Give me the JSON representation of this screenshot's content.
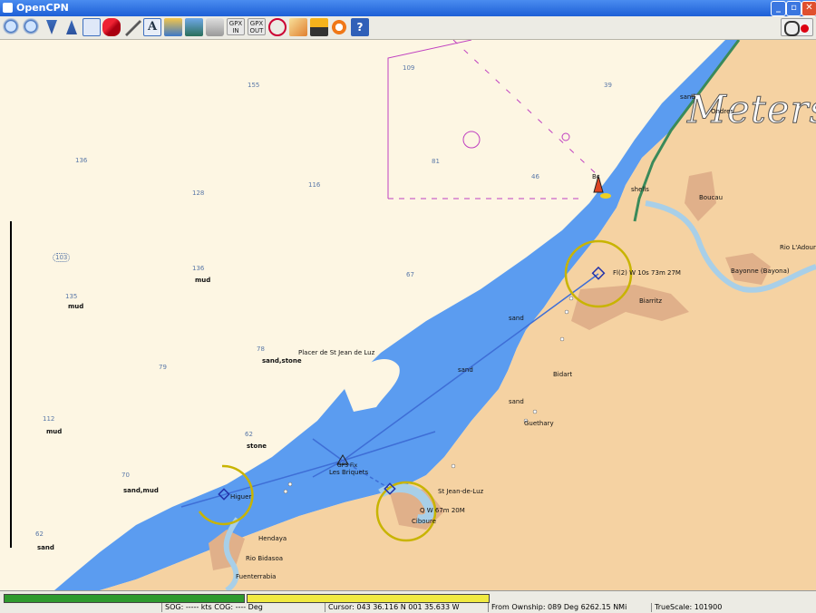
{
  "window": {
    "title": "OpenCPN",
    "min": "_",
    "max": "▫",
    "close": "✕"
  },
  "toolbar": {
    "gpx_in": "GPX IN",
    "gpx_out": "GPX OUT"
  },
  "overlay": {
    "units": "Meters"
  },
  "depths": {
    "d109": "109",
    "d155": "155",
    "d39": "39",
    "d136a": "136",
    "d128": "128",
    "d116": "116",
    "d81": "81",
    "d46": "46",
    "d103": "103",
    "d136b": "136",
    "d135": "135",
    "d67": "67",
    "d78": "78",
    "d79": "79",
    "d112": "112",
    "d62": "62",
    "d70": "70",
    "d62b": "62"
  },
  "places": {
    "ondres": "Ondres",
    "boucau": "Boucau",
    "rio_ladour": "Rio L'Adour",
    "bayonne": "Bayonne (Bayona)",
    "biarritz": "Biarritz",
    "bidart": "Bidart",
    "guethary": "Guethary",
    "st_jean": "St Jean-de-Luz",
    "ciboure": "Ciboure",
    "hendaya": "Hendaya",
    "rio_bidasoa": "Rio Bidasoa",
    "fuenterrabia": "Fuenterrabia",
    "higuer": "Higuer",
    "placer": "Placer de St Jean de Luz",
    "les_briquets": "Les Briquets",
    "gps_fix": "GPS Fix"
  },
  "seabed": {
    "sand_top": "sand",
    "shells": "shells",
    "mud1": "mud",
    "mud2": "mud",
    "sand_mid": "sand",
    "sandstone": "sand,stone",
    "sand_c": "sand",
    "sand_g": "sand",
    "mud3": "mud",
    "stone": "stone",
    "sandmud": "sand,mud",
    "sand_bl": "sand"
  },
  "lights": {
    "biarritz": "Fl(2) W 10s 73m 27M",
    "ciboure": "Q W 67m 20M",
    "bc": "Bc"
  },
  "status": {
    "sog": "SOG: ----- kts  COG: ---- Deg",
    "cursor": "Cursor: 043 36.116 N 001 35.633 W",
    "ownship": "From Ownship: 089 Deg  6262.15 NMi",
    "truescale": "TrueScale:   101900"
  },
  "colors": {
    "water": "#5b9cf0",
    "land": "#f5d2a2",
    "sea_shallow": "#fdf6e3",
    "route": "#3e6ed6",
    "light_ring": "#c8b400"
  }
}
